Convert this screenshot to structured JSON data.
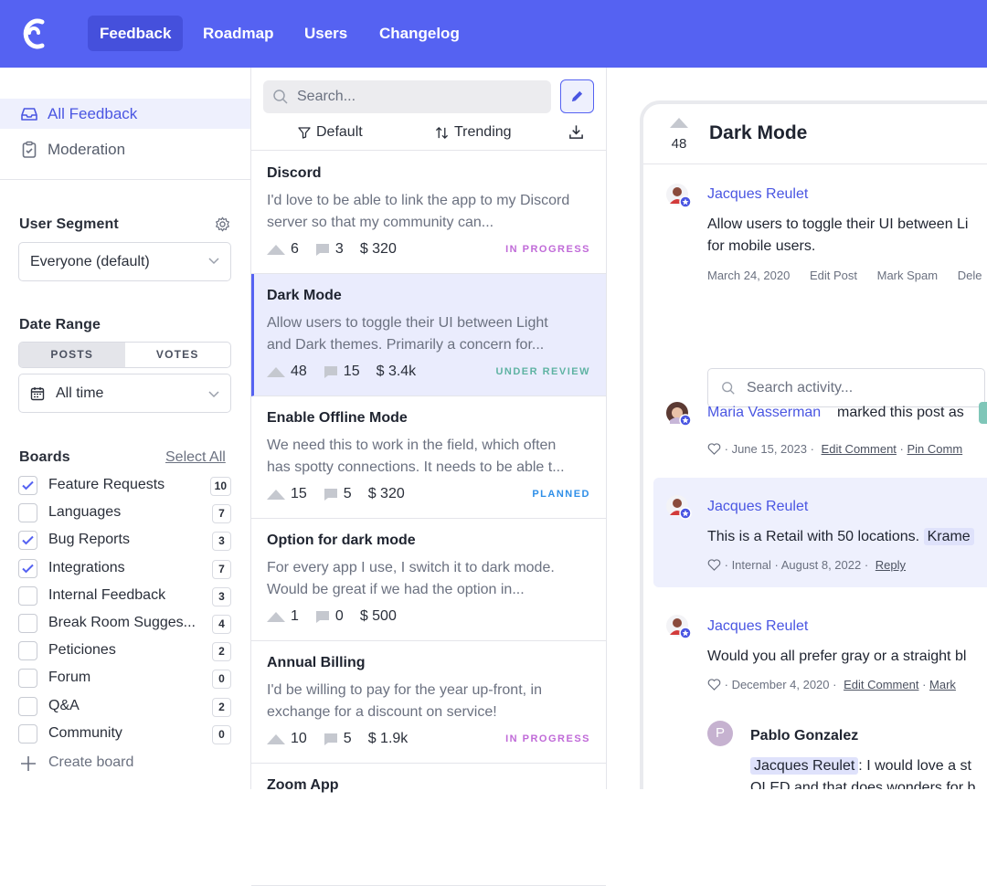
{
  "colors": {
    "accent": "#5562f2",
    "in_progress": "#c06ad8",
    "under_review": "#5fb3a3",
    "planned": "#2f8fe8"
  },
  "topnav": {
    "items": [
      {
        "label": "Feedback",
        "active": true
      },
      {
        "label": "Roadmap"
      },
      {
        "label": "Users"
      },
      {
        "label": "Changelog"
      }
    ]
  },
  "sidebar": {
    "views": [
      {
        "label": "All Feedback",
        "icon": "inbox-icon",
        "active": true
      },
      {
        "label": "Moderation",
        "icon": "clipboard-icon"
      }
    ],
    "segment": {
      "title": "User Segment",
      "value": "Everyone (default)"
    },
    "date": {
      "title": "Date Range",
      "tabs": [
        "POSTS",
        "VOTES"
      ],
      "active_tab": "POSTS",
      "value": "All time"
    },
    "boards": {
      "title": "Boards",
      "select_all": "Select All",
      "create": "Create board",
      "items": [
        {
          "label": "Feature Requests",
          "count": "10",
          "checked": true
        },
        {
          "label": "Languages",
          "count": "7",
          "checked": false
        },
        {
          "label": "Bug Reports",
          "count": "3",
          "checked": true
        },
        {
          "label": "Integrations",
          "count": "7",
          "checked": true
        },
        {
          "label": "Internal Feedback",
          "count": "3",
          "checked": false
        },
        {
          "label": "Break Room Sugges...",
          "count": "4",
          "checked": false
        },
        {
          "label": "Peticiones",
          "count": "2",
          "checked": false
        },
        {
          "label": "Forum",
          "count": "0",
          "checked": false
        },
        {
          "label": "Q&A",
          "count": "2",
          "checked": false
        },
        {
          "label": "Community",
          "count": "0",
          "checked": false
        }
      ]
    }
  },
  "list": {
    "search_placeholder": "Search...",
    "sort": {
      "filter": "Default",
      "order": "Trending"
    },
    "posts": [
      {
        "title": "Discord",
        "desc": "I'd love to be able to link the app to my Discord server so that my community can...",
        "votes": "6",
        "comments": "3",
        "mrr": "$ 320",
        "status": "IN PROGRESS",
        "status_color": "#c06ad8"
      },
      {
        "title": "Dark Mode",
        "desc": "Allow users to toggle their UI between Light and Dark themes. Primarily a concern for...",
        "votes": "48",
        "comments": "15",
        "mrr": "$ 3.4k",
        "status": "UNDER REVIEW",
        "status_color": "#5fb3a3",
        "selected": true
      },
      {
        "title": "Enable Offline Mode",
        "desc": "We need this to work in the field, which often has spotty connections. It needs to be able t...",
        "votes": "15",
        "comments": "5",
        "mrr": "$ 320",
        "status": "PLANNED",
        "status_color": "#2f8fe8"
      },
      {
        "title": "Option for dark mode",
        "desc": "For every app I use, I switch it to dark mode. Would be great if we had the option in...",
        "votes": "1",
        "comments": "0",
        "mrr": "$ 500",
        "status": "",
        "status_color": "#999"
      },
      {
        "title": "Annual Billing",
        "desc": "I'd be willing to pay for the year up-front, in exchange for a discount on service!",
        "votes": "10",
        "comments": "5",
        "mrr": "$ 1.9k",
        "status": "IN PROGRESS",
        "status_color": "#c06ad8"
      },
      {
        "title": "Zoom App",
        "desc": "",
        "votes": "",
        "comments": "",
        "mrr": "",
        "status": "",
        "status_color": "#999"
      }
    ]
  },
  "detail": {
    "title": "Dark Mode",
    "votes": "48",
    "post": {
      "author": "Jacques Reulet",
      "line1": "Allow users to toggle their UI between Li",
      "line2": "for mobile users.",
      "date": "March 24, 2020",
      "actions": [
        "Edit Post",
        "Mark Spam",
        "Dele"
      ]
    },
    "activity_placeholder": "Search activity...",
    "events": [
      {
        "author": "Maria Vasserman",
        "text": "marked this post as",
        "meta_plain": "· June 15, 2023 ·",
        "links": [
          "Edit Comment",
          "Pin Comm"
        ]
      },
      {
        "author": "Jacques Reulet",
        "text": "This is a Retail with 50 locations.",
        "mention": "Krame",
        "meta_plain": "· Internal  · August 8, 2022 ·",
        "links": [
          "Reply"
        ]
      },
      {
        "author": "Jacques Reulet",
        "text": "Would you all prefer gray or a straight bl",
        "meta_plain": "· December 4, 2020 ·",
        "links": [
          "Edit Comment",
          "Mark"
        ]
      }
    ],
    "reply": {
      "initial": "P",
      "author": "Pablo Gonzalez",
      "mention": "Jacques Reulet",
      "text": ": I would love a st",
      "line2": "OLED and that does wonders for b"
    }
  }
}
